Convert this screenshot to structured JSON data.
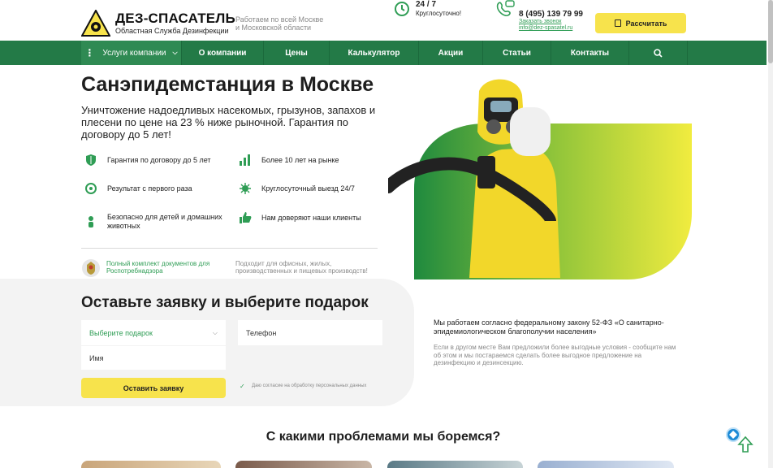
{
  "header": {
    "brand": "ДЕЗ-СПАСАТЕЛЬ",
    "brand_sub": "Областная Служба Дезинфекции",
    "region": "Работаем по всей Москве и Московской области",
    "hours_title": "24 / 7",
    "hours_sub": "Круглосуточно!",
    "phone": "8 (495) 139 79 99",
    "callback_link": "Заказать звонок",
    "email": "info@dez-spasatel.ru",
    "calc_button": "Рассчитать"
  },
  "nav": {
    "items": [
      "Услуги компании",
      "О компании",
      "Цены",
      "Калькулятор",
      "Акции",
      "Статьи",
      "Контакты"
    ]
  },
  "hero": {
    "title": "Санэпидемстанция в Москве",
    "lead": "Уничтожение надоедливых насекомых, грызунов, запахов и плесени по цене на 23 % ниже рыночной. Гарантия по договору до 5 лет!",
    "features": [
      {
        "text": "Гарантия по договору до 5 лет",
        "icon": "shield-icon"
      },
      {
        "text": "Более 10 лет на рынке",
        "icon": "bar-chart-icon"
      },
      {
        "text": "Результат с первого раза",
        "icon": "target-icon"
      },
      {
        "text": "Круглосуточный выезд 24/7",
        "icon": "virus-icon"
      },
      {
        "text": "Безопасно для детей и домашних животных",
        "icon": "child-icon"
      },
      {
        "text": "Нам доверяют наши клиенты",
        "icon": "thumbs-up-icon"
      }
    ],
    "docs_link": "Полный комплект документов для Роспотребнадзора",
    "suitable": "Подходит для офисных, жилых, производственных и пищевых производств!"
  },
  "form": {
    "title": "Оставьте заявку и выберите подарок",
    "gift_select": "Выберите подарок",
    "phone_placeholder": "Телефон",
    "name_placeholder": "Имя",
    "submit": "Оставить заявку",
    "consent": "Даю согласие на обработку персональных данных"
  },
  "law": {
    "title": "Мы работаем согласно федеральному закону 52-ФЗ «О санитарно-эпидемиологическом благополучии населения»",
    "text": "Если в другом месте Вам предложили более выгодные условия - сообщите нам об этом и мы постараемся сделать более выгодное предложение на дезинфекцию и дезинсекцию."
  },
  "problems": {
    "title": "С какими проблемами мы боремся?"
  },
  "colors": {
    "green": "#237a47",
    "yellow": "#f7e34c",
    "accent_green": "#2f9d55"
  }
}
